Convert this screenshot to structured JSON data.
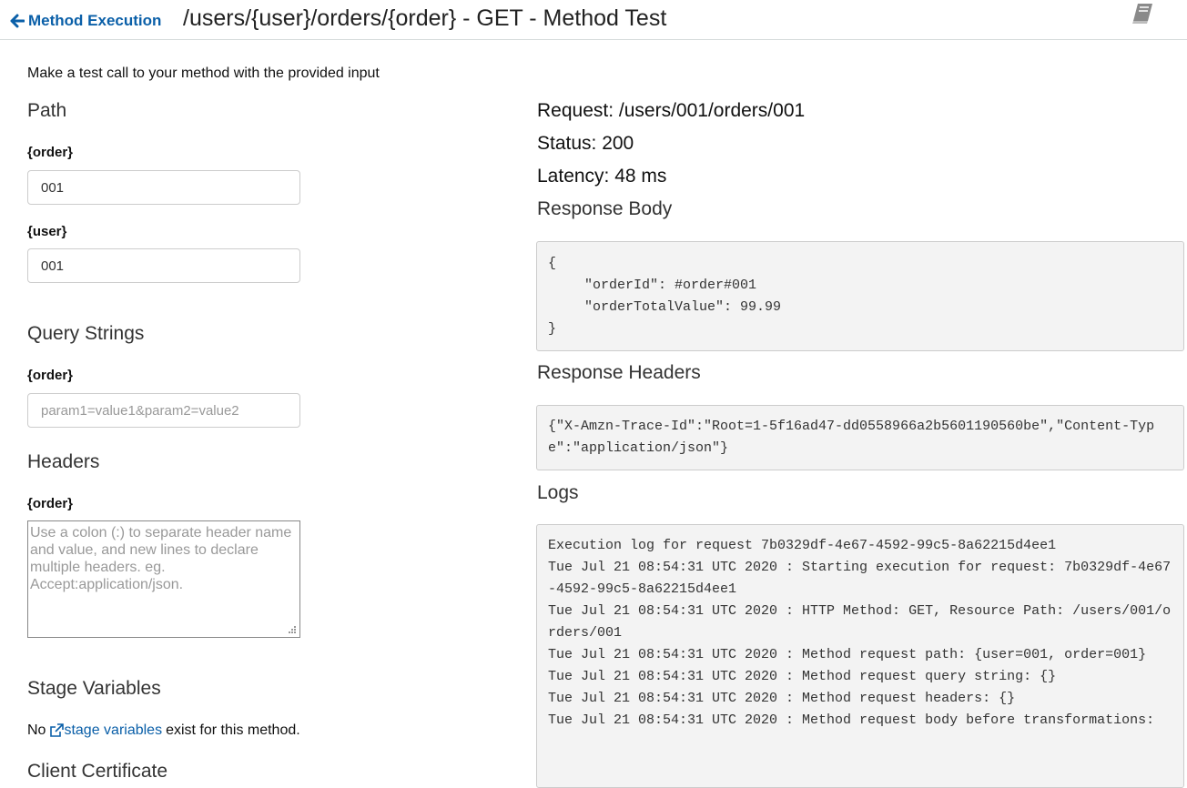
{
  "header": {
    "back_label": "Method Execution",
    "title": "/users/{user}/orders/{order} - GET - Method Test"
  },
  "intro": "Make a test call to your method with the provided input",
  "path": {
    "heading": "Path",
    "order_label": "{order}",
    "order_value": "001",
    "user_label": "{user}",
    "user_value": "001"
  },
  "query": {
    "heading": "Query Strings",
    "label": "{order}",
    "placeholder": "param1=value1&param2=value2"
  },
  "headers": {
    "heading": "Headers",
    "label": "{order}",
    "placeholder": "Use a colon (:) to separate header name and value, and new lines to declare multiple headers. eg. Accept:application/json."
  },
  "stage": {
    "heading": "Stage Variables",
    "prefix": "No",
    "link": "stage variables",
    "suffix": "exist for this method."
  },
  "client_cert": {
    "heading": "Client Certificate"
  },
  "result": {
    "request": "Request: /users/001/orders/001",
    "status": "Status: 200",
    "latency": "Latency: 48 ms",
    "body_heading": "Response Body",
    "body": {
      "open": "{",
      "lines": [
        "\"orderId\": #order#001",
        "\"orderTotalValue\": 99.99"
      ],
      "close": "}"
    },
    "headers_heading": "Response Headers",
    "headers_text": "{\"X-Amzn-Trace-Id\":\"Root=1-5f16ad47-dd0558966a2b5601190560be\",\"Content-Type\":\"application/json\"}",
    "logs_heading": "Logs",
    "logs": [
      "Execution log for request 7b0329df-4e67-4592-99c5-8a62215d4ee1",
      "Tue Jul 21 08:54:31 UTC 2020 : Starting execution for request: 7b0329df-4e67-4592-99c5-8a62215d4ee1",
      "Tue Jul 21 08:54:31 UTC 2020 : HTTP Method: GET, Resource Path: /users/001/orders/001",
      "Tue Jul 21 08:54:31 UTC 2020 : Method request path: {user=001, order=001}",
      "Tue Jul 21 08:54:31 UTC 2020 : Method request query string: {}",
      "Tue Jul 21 08:54:31 UTC 2020 : Method request headers: {}",
      "Tue Jul 21 08:54:31 UTC 2020 : Method request body before transformations:"
    ]
  },
  "colors": {
    "link": "#0a5fa8",
    "code_bg": "#f3f3f3",
    "border": "#cccccc"
  },
  "icons": {
    "back": "arrow-left-icon",
    "docs": "book-icon",
    "external": "external-link-icon"
  }
}
